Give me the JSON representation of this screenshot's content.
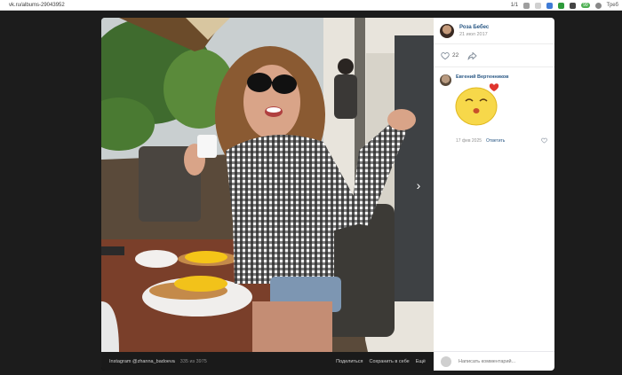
{
  "browser": {
    "url": "vk.ru/albums-29043952",
    "page_indicator": "1/1",
    "badge_count": "99",
    "last_label": "Треб"
  },
  "viewer": {
    "caption_source": "Instagram @zhanna_badoeva",
    "photo_counter": "335 из 3975",
    "actions": {
      "share": "Поделиться",
      "save": "Сохранить в себе",
      "more": "Ещё"
    },
    "next_arrow": "›"
  },
  "sidebar": {
    "author_name": "Роза Бебес",
    "author_date": "21 июл 2017",
    "likes_count": "22",
    "comment": {
      "author": "Евгений Вертенников",
      "date": "17 фев 2025",
      "reply_label": "Ответить"
    },
    "compose_placeholder": "Написать комментарий..."
  },
  "colors": {
    "link": "#2a5885",
    "muted": "#939393",
    "dim_background": "#1c1c1c"
  }
}
